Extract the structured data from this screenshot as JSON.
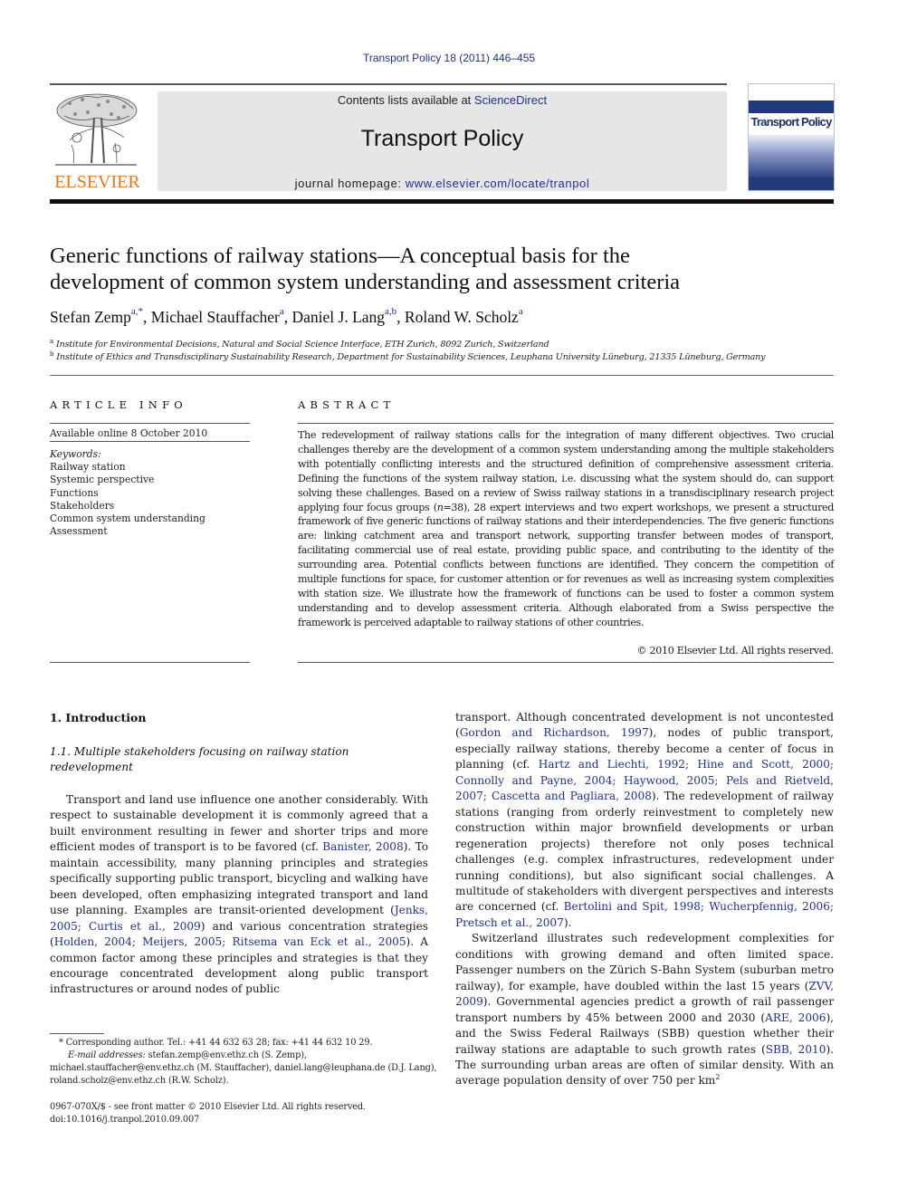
{
  "running_head": "Transport Policy 18 (2011) 446–455",
  "masthead": {
    "publisher_logo_text": "ELSEVIER",
    "contents_prefix": "Contents lists available at ",
    "contents_link": "ScienceDirect",
    "journal_name": "Transport Policy",
    "homepage_prefix": "journal homepage: ",
    "homepage_link": "www.elsevier.com/locate/tranpol",
    "cover_title": "Transport Policy"
  },
  "colors": {
    "link": "#1f2f8f",
    "elsevier_orange": "#e87722",
    "masthead_gray": "#e6e6e6",
    "cover_blue": "#203a7a"
  },
  "article": {
    "title_line_1": "Generic functions of railway stations—A conceptual basis for the",
    "title_line_2": "development of common system understanding and assessment criteria",
    "authors": [
      {
        "name": "Stefan Zemp",
        "sup": "a,*",
        "sep": ", "
      },
      {
        "name": "Michael Stauffacher",
        "sup": "a",
        "sep": ", "
      },
      {
        "name": "Daniel J. Lang",
        "sup": "a,b",
        "sep": ", "
      },
      {
        "name": "Roland W. Scholz",
        "sup": "a",
        "sep": ""
      }
    ],
    "affiliations": [
      {
        "mark": "a",
        "text": "Institute for Environmental Decisions, Natural and Social Science Interface, ETH Zurich, 8092 Zurich, Switzerland"
      },
      {
        "mark": "b",
        "text": "Institute of Ethics and Transdisciplinary Sustainability Research, Department for Sustainability Sciences, Leuphana University Lüneburg, 21335 Lüneburg, Germany"
      }
    ]
  },
  "article_info": {
    "heading": "ARTICLE INFO",
    "available_online": "Available online 8 October 2010",
    "keywords_label": "Keywords:",
    "keywords": [
      "Railway station",
      "Systemic perspective",
      "Functions",
      "Stakeholders",
      "Common system understanding",
      "Assessment"
    ]
  },
  "abstract": {
    "heading": "ABSTRACT",
    "text_1": "The redevelopment of railway stations calls for the integration of many different objectives. Two crucial challenges thereby are the development of a common system understanding among the multiple stakeholders with potentially conflicting interests and the structured definition of comprehensive assessment criteria. Defining the functions of the system railway station, i.e. discussing what the system should do, can support solving these challenges. Based on a review of Swiss railway stations in a transdisciplinary research project applying four focus groups (",
    "n_var": "n",
    "text_2": "=38), 28 expert interviews and two expert workshops, we present a structured framework of five generic functions of railway stations and their interdependencies. The five generic functions are: linking catchment area and transport network, supporting transfer between modes of transport, facilitating commercial use of real estate, providing public space, and contributing to the identity of the surrounding area. Potential conflicts between functions are identified. They concern the competition of multiple functions for space, for customer attention or for revenues as well as increasing system complexities with station size. We illustrate how the framework of functions can be used to foster a common system understanding and to develop assessment criteria. Although elaborated from a Swiss perspective the framework is perceived adaptable to railway stations of other countries.",
    "copyright": "© 2010 Elsevier Ltd. All rights reserved."
  },
  "body": {
    "section_heading": "1.  Introduction",
    "subsection_heading": "1.1.  Multiple stakeholders focusing on railway station redevelopment",
    "left_para": [
      {
        "t": "Transport and land use influence one another considerably. With respect to sustainable development it is commonly agreed that a built environment resulting in fewer and shorter trips and more efficient modes of transport is to be favored (cf. "
      },
      {
        "link": "Banister, 2008"
      },
      {
        "t": "). To maintain accessibility, many planning principles and strategies specifically supporting public transport, bicycling and walking have been developed, often emphasizing integrated transport and land use planning. Examples are transit-oriented development ("
      },
      {
        "link": "Jenks, 2005; Curtis et al., 2009"
      },
      {
        "t": ") and various concentration strategies ("
      },
      {
        "link": "Holden, 2004; Meijers, 2005; Ritsema van Eck et al., 2005"
      },
      {
        "t": "). A common factor among these principles and strategies is that they encourage concentrated development along public transport infrastructures or around nodes of public"
      }
    ],
    "right_para_1": [
      {
        "t": "transport. Although concentrated development is not uncontested ("
      },
      {
        "link": "Gordon and Richardson, 1997"
      },
      {
        "t": "), nodes of public transport, especially railway stations, thereby become a center of focus in planning (cf. "
      },
      {
        "link": "Hartz and Liechti, 1992; Hine and Scott, 2000; Connolly and Payne, 2004; Haywood, 2005; Pels and Rietveld, 2007; Cascetta and Pagliara, 2008"
      },
      {
        "t": "). The redevelopment of railway stations (ranging from orderly reinvestment to completely new construction within major brownfield developments or urban regeneration projects) therefore not only poses technical challenges (e.g. complex infrastructures, redevelopment under running conditions), but also significant social challenges. A multitude of stakeholders with divergent perspectives and interests are concerned (cf. "
      },
      {
        "link": "Bertolini and Spit, 1998; Wucherpfennig, 2006; Pretsch et al., 2007"
      },
      {
        "t": ")."
      }
    ],
    "right_para_2": [
      {
        "t": "Switzerland illustrates such redevelopment complexities for conditions with growing demand and often limited space. Passenger numbers on the Zürich S-Bahn System (suburban metro railway), for example, have doubled within the last 15 years ("
      },
      {
        "link": "ZVV, 2009"
      },
      {
        "t": "). Governmental agencies predict a growth of rail passenger transport numbers by 45% between 2000 and 2030 ("
      },
      {
        "link": "ARE, 2006"
      },
      {
        "t": "), and the Swiss Federal Railways (SBB) question whether their railway stations are adaptable to such growth rates ("
      },
      {
        "link": "SBB, 2010"
      },
      {
        "t": "). The surrounding urban areas are often of similar density. With an average population density of over 750 per km"
      },
      {
        "sup": "2"
      }
    ]
  },
  "footnotes": {
    "corresponding": "* Corresponding author. Tel.: +41 44 632 63 28; fax: +41 44 632 10 29.",
    "email_label": "E-mail addresses:",
    "emails": " stefan.zemp@env.ethz.ch (S. Zemp), michael.stauffacher@env.ethz.ch (M. Stauffacher), daniel.lang@leuphana.de (D.J. Lang), roland.scholz@env.ethz.ch (R.W. Scholz).",
    "front_matter": "0967-070X/$ - see front matter © 2010 Elsevier Ltd. All rights reserved.",
    "doi": "doi:10.1016/j.tranpol.2010.09.007"
  }
}
